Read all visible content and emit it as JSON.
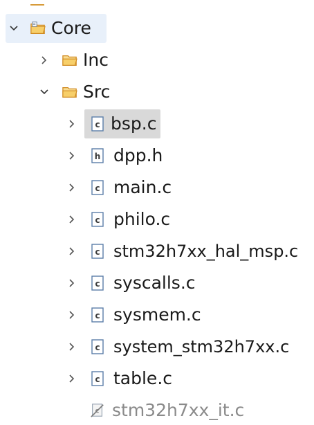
{
  "tree": {
    "items": [
      {
        "label": "Core",
        "state": "expanded",
        "icon": "source-folder-icon"
      },
      {
        "label": "Inc",
        "state": "collapsed",
        "icon": "folder-icon"
      },
      {
        "label": "Src",
        "state": "expanded",
        "icon": "folder-icon"
      },
      {
        "label": "bsp.c",
        "state": "collapsed",
        "icon": "c-file-icon"
      },
      {
        "label": "dpp.h",
        "state": "collapsed",
        "icon": "h-file-icon"
      },
      {
        "label": "main.c",
        "state": "collapsed",
        "icon": "c-file-icon"
      },
      {
        "label": "philo.c",
        "state": "collapsed",
        "icon": "c-file-icon"
      },
      {
        "label": "stm32h7xx_hal_msp.c",
        "state": "collapsed",
        "icon": "c-file-icon"
      },
      {
        "label": "syscalls.c",
        "state": "collapsed",
        "icon": "c-file-icon"
      },
      {
        "label": "sysmem.c",
        "state": "collapsed",
        "icon": "c-file-icon"
      },
      {
        "label": "system_stm32h7xx.c",
        "state": "collapsed",
        "icon": "c-file-icon"
      },
      {
        "label": "table.c",
        "state": "collapsed",
        "icon": "c-file-icon"
      },
      {
        "label": "stm32h7xx_it.c",
        "state": "excluded",
        "icon": "excluded-c-file-icon"
      }
    ]
  },
  "colors": {
    "folder": "#e4a33a",
    "folder_fill": "#f9dd92",
    "file_border": "#5b7ea9",
    "excluded_text": "#8a8a8a",
    "selection_blue": "#e8f0fa",
    "selection_grey": "#d9d9d9"
  }
}
